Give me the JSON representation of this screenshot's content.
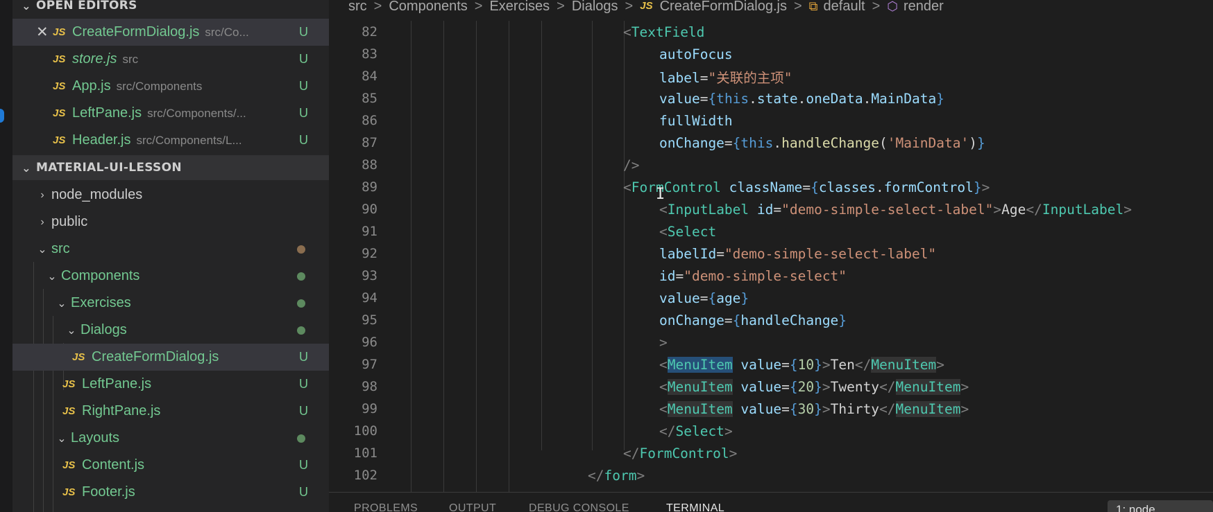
{
  "sidebar": {
    "open_editors_header": "OPEN EDITORS",
    "open_editors": [
      {
        "name": "CreateFormDialog.js",
        "path": "src/Co...",
        "status": "U",
        "active": true,
        "close": "✕"
      },
      {
        "name": "store.js",
        "path": "src",
        "status": "U",
        "italic": true
      },
      {
        "name": "App.js",
        "path": "src/Components",
        "status": "U"
      },
      {
        "name": "LeftPane.js",
        "path": "src/Components/...",
        "status": "U"
      },
      {
        "name": "Header.js",
        "path": "src/Components/L...",
        "status": "U"
      }
    ],
    "project_header": "MATERIAL-UI-LESSON",
    "tree": [
      {
        "label": "node_modules",
        "type": "folder"
      },
      {
        "label": "public",
        "type": "folder"
      },
      {
        "label": "src",
        "type": "folder"
      },
      {
        "label": "Components",
        "type": "folder"
      },
      {
        "label": "Exercises",
        "type": "folder"
      },
      {
        "label": "Dialogs",
        "type": "folder"
      },
      {
        "label": "CreateFormDialog.js",
        "type": "file",
        "status": "U"
      },
      {
        "label": "LeftPane.js",
        "type": "file",
        "status": "U"
      },
      {
        "label": "RightPane.js",
        "type": "file",
        "status": "U"
      },
      {
        "label": "Layouts",
        "type": "folder"
      },
      {
        "label": "Content.js",
        "type": "file",
        "status": "U"
      },
      {
        "label": "Footer.js",
        "type": "file",
        "status": "U"
      }
    ],
    "js_badge": "JS"
  },
  "breadcrumb": {
    "items": [
      "src",
      "Components",
      "Exercises",
      "Dialogs",
      "CreateFormDialog.js",
      "default",
      "render"
    ],
    "separator": ">"
  },
  "editor": {
    "line_numbers": [
      "82",
      "83",
      "84",
      "85",
      "86",
      "87",
      "88",
      "89",
      "90",
      "91",
      "92",
      "93",
      "94",
      "95",
      "96",
      "97",
      "98",
      "99",
      "100",
      "101",
      "102"
    ]
  },
  "panel": {
    "tabs": [
      "PROBLEMS",
      "OUTPUT",
      "DEBUG CONSOLE",
      "TERMINAL"
    ],
    "active_tab": "TERMINAL",
    "terminal_select": "1: node"
  },
  "colors": {
    "git_untracked": "#73c991",
    "js_icon": "#e8c14a",
    "jsx_tag": "#4ec9b0",
    "jsx_attr": "#9cdcfe",
    "string": "#ce9178"
  }
}
